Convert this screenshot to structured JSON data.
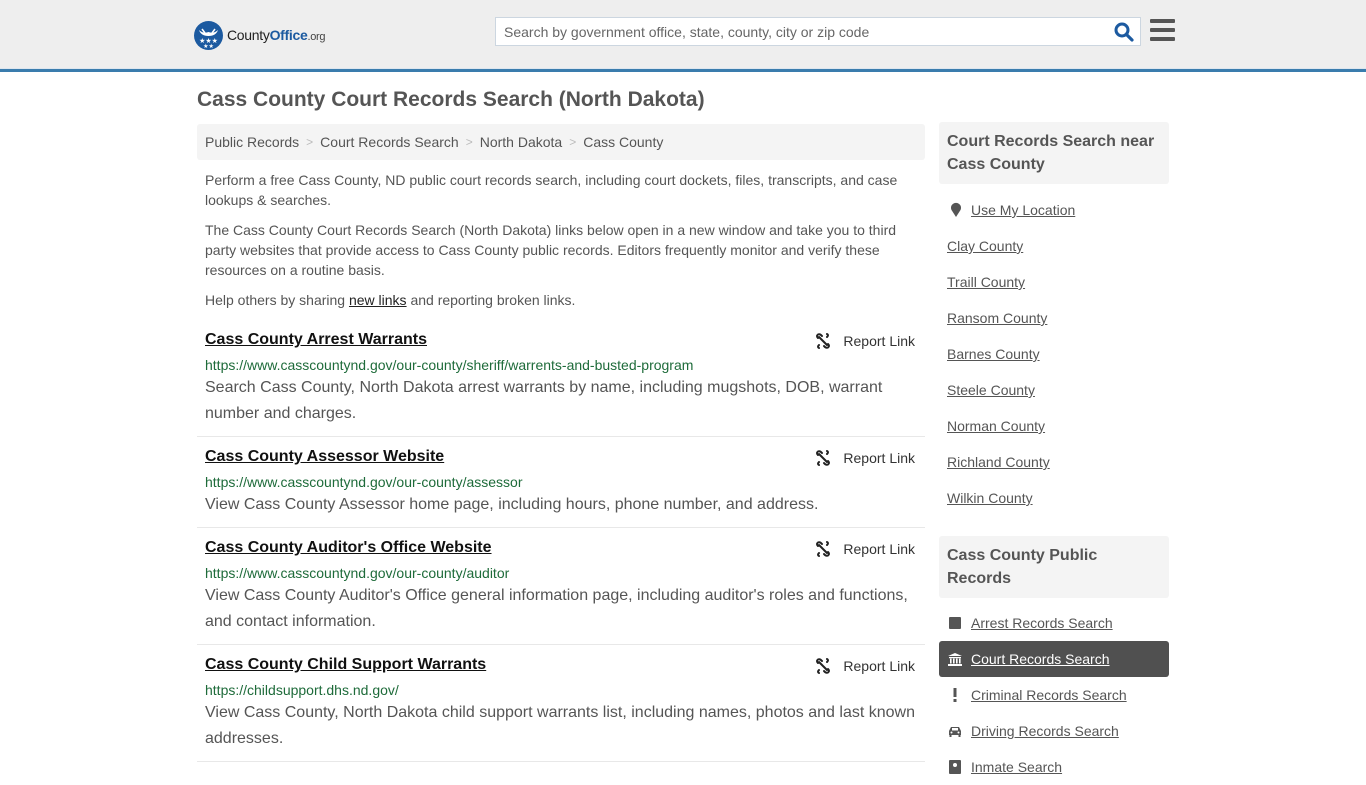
{
  "header": {
    "logo": {
      "county": "County",
      "office": "Office",
      "org": ".org"
    },
    "search_placeholder": "Search by government office, state, county, city or zip code",
    "colors": {
      "accent": "#3a7cad",
      "brand": "#1c5aa0"
    }
  },
  "page_title": "Cass County Court Records Search (North Dakota)",
  "breadcrumb": [
    "Public Records",
    "Court Records Search",
    "North Dakota",
    "Cass County"
  ],
  "intro": {
    "p1": "Perform a free Cass County, ND public court records search, including court dockets, files, transcripts, and case lookups & searches.",
    "p2": "The Cass County Court Records Search (North Dakota) links below open in a new window and take you to third party websites that provide access to Cass County public records. Editors frequently monitor and verify these resources on a routine basis.",
    "p3_before": "Help others by sharing ",
    "p3_link": "new links",
    "p3_after": " and reporting broken links."
  },
  "report_label": "Report Link",
  "results": [
    {
      "title": "Cass County Arrest Warrants",
      "url": "https://www.casscountynd.gov/our-county/sheriff/warrents-and-busted-program",
      "description": "Search Cass County, North Dakota arrest warrants by name, including mugshots, DOB, warrant number and charges."
    },
    {
      "title": "Cass County Assessor Website",
      "url": "https://www.casscountynd.gov/our-county/assessor",
      "description": "View Cass County Assessor home page, including hours, phone number, and address."
    },
    {
      "title": "Cass County Auditor's Office Website",
      "url": "https://www.casscountynd.gov/our-county/auditor",
      "description": "View Cass County Auditor's Office general information page, including auditor's roles and functions, and contact information."
    },
    {
      "title": "Cass County Child Support Warrants",
      "url": "https://childsupport.dhs.nd.gov/",
      "description": "View Cass County, North Dakota child support warrants list, including names, photos and last known addresses."
    }
  ],
  "sidebar": {
    "nearby_title": "Court Records Search near Cass County",
    "use_location": "Use My Location",
    "nearby": [
      "Clay County",
      "Traill County",
      "Ransom County",
      "Barnes County",
      "Steele County",
      "Norman County",
      "Richland County",
      "Wilkin County"
    ],
    "public_title": "Cass County Public Records",
    "public_records": [
      {
        "label": "Arrest Records Search",
        "icon": "square-icon",
        "active": false
      },
      {
        "label": "Court Records Search",
        "icon": "courthouse-icon",
        "active": true
      },
      {
        "label": "Criminal Records Search",
        "icon": "exclamation-icon",
        "active": false
      },
      {
        "label": "Driving Records Search",
        "icon": "car-icon",
        "active": false
      },
      {
        "label": "Inmate Search",
        "icon": "id-card-icon",
        "active": false
      }
    ]
  }
}
